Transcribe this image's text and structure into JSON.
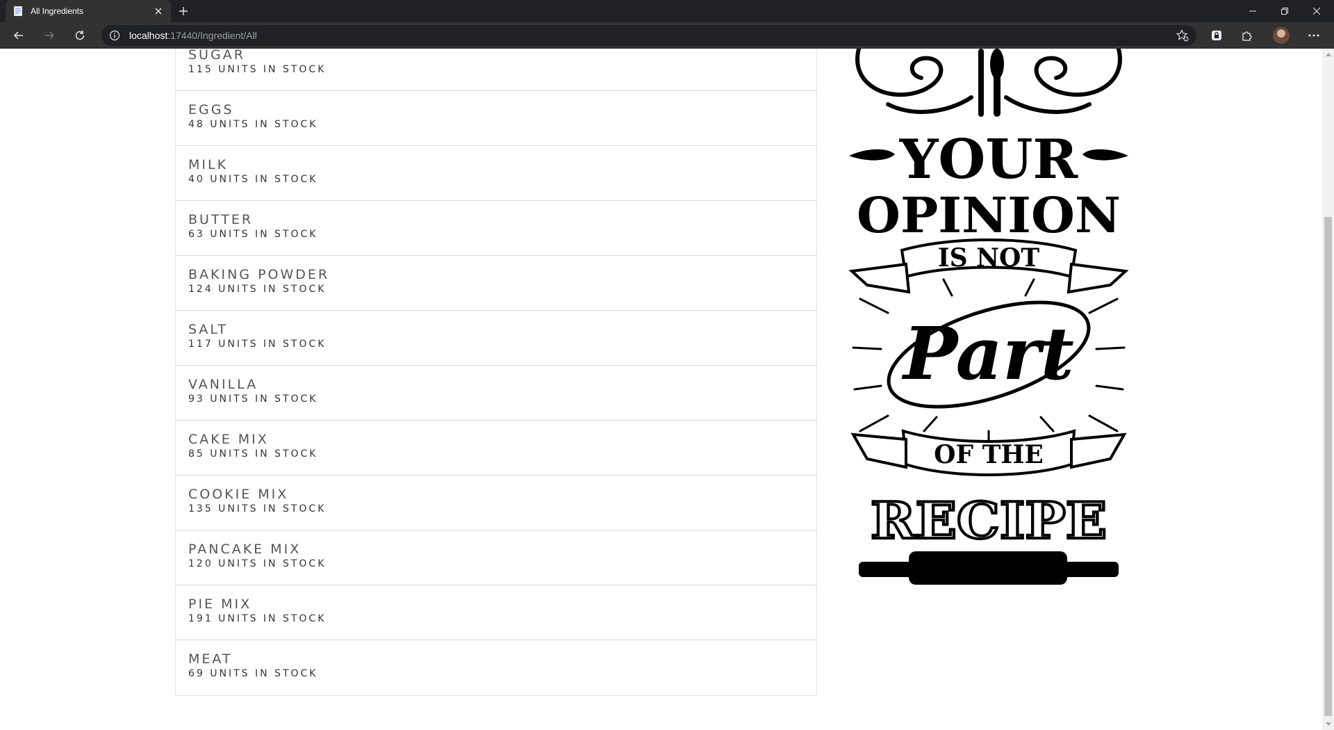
{
  "browser": {
    "tab_title": "All Ingredients",
    "url_host": "localhost",
    "url_path": ":17440/Ingredient/All"
  },
  "ingredients": [
    {
      "name": "SUGAR",
      "stock": "115 UNITS IN STOCK"
    },
    {
      "name": "EGGS",
      "stock": "48 UNITS IN STOCK"
    },
    {
      "name": "MILK",
      "stock": "40 UNITS IN STOCK"
    },
    {
      "name": "BUTTER",
      "stock": "63 UNITS IN STOCK"
    },
    {
      "name": "BAKING POWDER",
      "stock": "124 UNITS IN STOCK"
    },
    {
      "name": "SALT",
      "stock": "117 UNITS IN STOCK"
    },
    {
      "name": "VANILLA",
      "stock": "93 UNITS IN STOCK"
    },
    {
      "name": "CAKE MIX",
      "stock": "85 UNITS IN STOCK"
    },
    {
      "name": "COOKIE MIX",
      "stock": "135 UNITS IN STOCK"
    },
    {
      "name": "PANCAKE MIX",
      "stock": "120 UNITS IN STOCK"
    },
    {
      "name": "PIE MIX",
      "stock": "191 UNITS IN STOCK"
    },
    {
      "name": "MEAT",
      "stock": "69 UNITS IN STOCK"
    }
  ],
  "poster": {
    "line1": "YOUR",
    "line2": "OPINION",
    "line3": "IS NOT",
    "line4": "Part",
    "line5": "OF THE",
    "line6": "RECIPE"
  }
}
